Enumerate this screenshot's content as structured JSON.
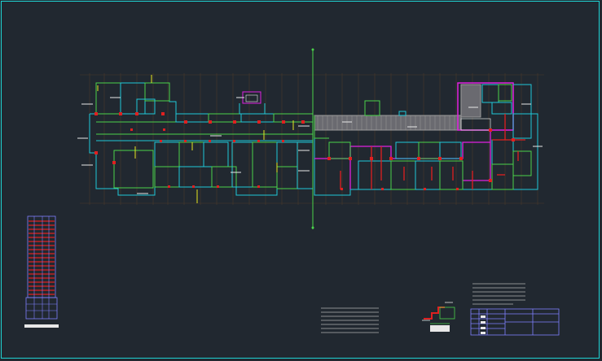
{
  "colors": {
    "background": "#212830",
    "border": "#1fd3d3",
    "wall_cyan": "#20c8d8",
    "wall_green": "#4ad24a",
    "column_red": "#e02020",
    "magenta": "#e020e0",
    "yellow": "#e8e820",
    "white": "#e8e8e8",
    "grid_dark": "#4a3a2a",
    "hatch_gray": "#9a9a9a",
    "violet": "#8080ff"
  },
  "drawing": {
    "left_plan": "floor-plan-left",
    "right_plan": "floor-plan-right",
    "section_line": "vertical-section-line",
    "legend": "schedule-legend",
    "notes_center": "general-notes",
    "detail": "stair-detail",
    "title_block": "title-block"
  }
}
